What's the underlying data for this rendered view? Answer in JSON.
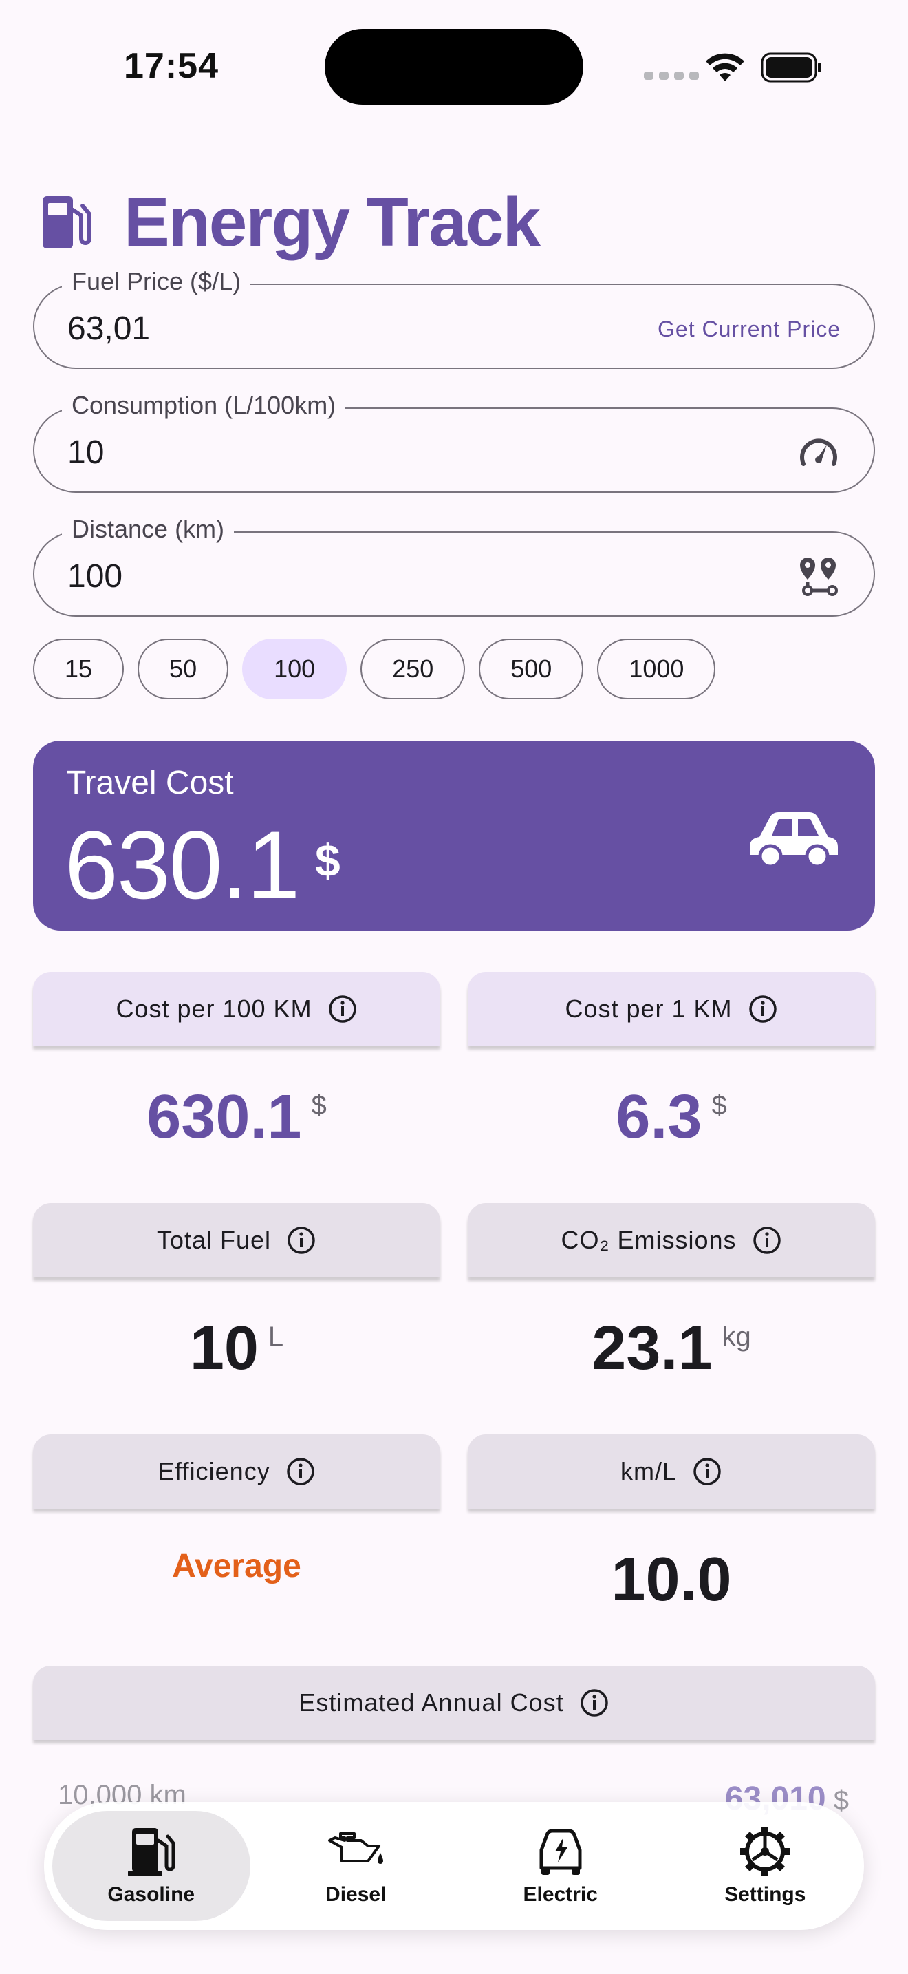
{
  "status": {
    "time": "17:54"
  },
  "app": {
    "title": "Energy Track"
  },
  "fields": {
    "fuel_price": {
      "label": "Fuel Price ($/L)",
      "value": "63,01",
      "action": "Get Current Price"
    },
    "consumption": {
      "label": "Consumption (L/100km)",
      "value": "10",
      "icon": "speedometer-icon"
    },
    "distance": {
      "label": "Distance (km)",
      "value": "100",
      "icon": "route-pins-icon"
    }
  },
  "distance_presets": {
    "options": [
      "15",
      "50",
      "100",
      "250",
      "500",
      "1000"
    ],
    "selected": "100"
  },
  "travel_cost": {
    "label": "Travel Cost",
    "value": "630.1",
    "unit": "$"
  },
  "stats": {
    "cost_per_100km": {
      "label": "Cost per 100 KM",
      "value": "630.1",
      "unit": "$"
    },
    "cost_per_1km": {
      "label": "Cost per 1 KM",
      "value": "6.3",
      "unit": "$"
    },
    "total_fuel": {
      "label": "Total Fuel",
      "value": "10",
      "unit": "L"
    },
    "co2": {
      "label": "CO₂ Emissions",
      "value": "23.1",
      "unit": "kg"
    },
    "efficiency": {
      "label": "Efficiency",
      "value": "Average"
    },
    "km_per_l": {
      "label": "km/L",
      "value": "10.0"
    }
  },
  "annual": {
    "label": "Estimated Annual Cost",
    "distance": "10,000 km",
    "amount": "63,010",
    "unit": "$"
  },
  "nav": {
    "items": [
      {
        "label": "Gasoline",
        "icon": "fuel-pump-icon",
        "active": true
      },
      {
        "label": "Diesel",
        "icon": "oil-can-icon",
        "active": false
      },
      {
        "label": "Electric",
        "icon": "electric-car-icon",
        "active": false
      },
      {
        "label": "Settings",
        "icon": "gear-icon",
        "active": false
      }
    ]
  },
  "colors": {
    "primary": "#6650a3",
    "chip_selected": "#e9ddff",
    "efficiency": "#e3601a"
  }
}
